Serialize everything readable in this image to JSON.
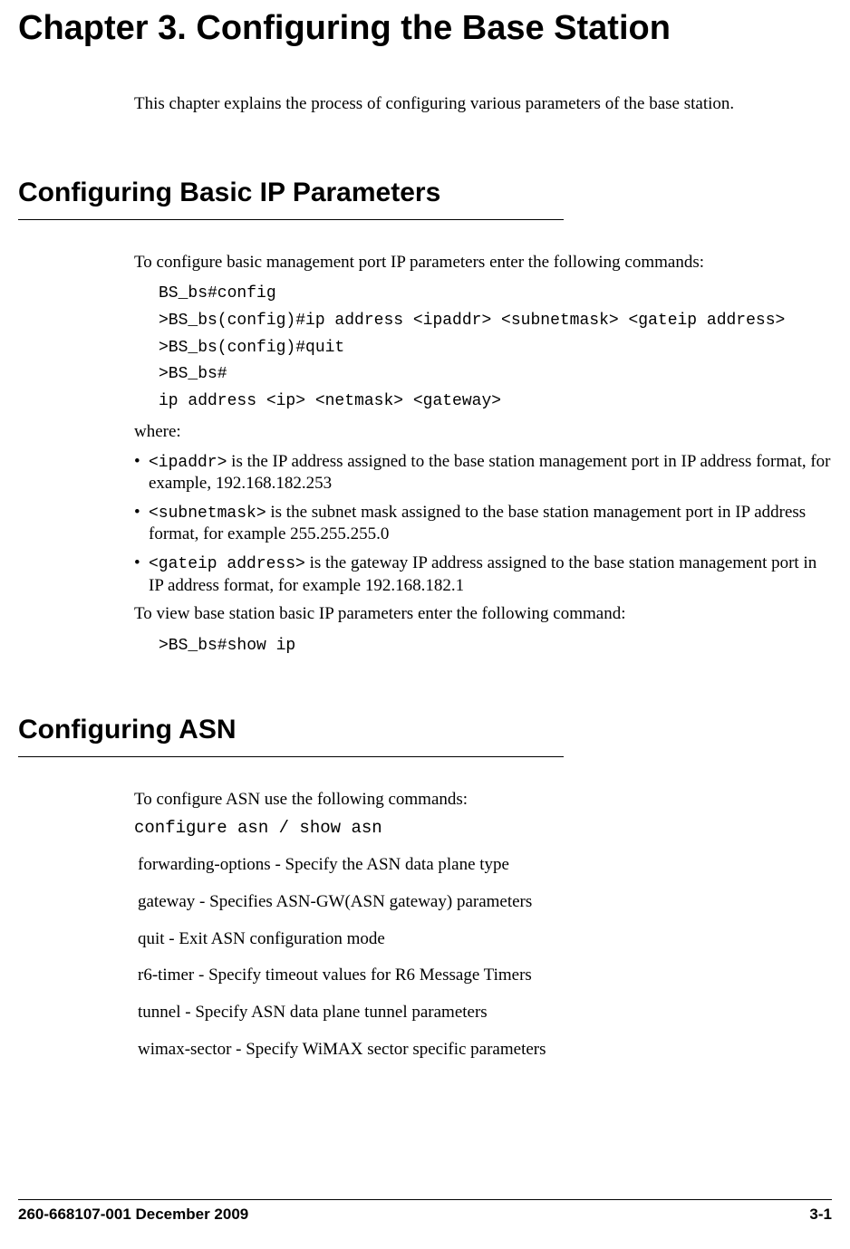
{
  "chapter": {
    "title": "Chapter 3. Configuring the Base Station",
    "intro": "This chapter explains the process of configuring various parameters of the base station."
  },
  "section1": {
    "heading": "Configuring Basic IP Parameters",
    "lead": "To configure basic management port IP parameters enter the following commands:",
    "code": "BS_bs#config\n>BS_bs(config)#ip address <ipaddr> <subnetmask> <gateip address>\n>BS_bs(config)#quit\n>BS_bs#\nip address <ip> <netmask> <gateway>",
    "where": "where:",
    "bullets": [
      {
        "term": "<ipaddr>",
        "desc": " is the IP address assigned to the base station management port in IP address format, for example, 192.168.182.253"
      },
      {
        "term": "<subnetmask>",
        "desc": " is the subnet mask assigned to the base station management port in IP address format, for example 255.255.255.0"
      },
      {
        "term": "<gateip address>",
        "desc": " is the gateway IP address assigned to the base station management port in IP address format, for example 192.168.182.1"
      }
    ],
    "view_text": "To view base station basic IP parameters enter the following command:",
    "view_cmd": ">BS_bs#show ip"
  },
  "section2": {
    "heading": "Configuring ASN",
    "lead": "To configure ASN use the following commands:",
    "cmd": "configure asn / show asn",
    "rows": [
      {
        "term": " forwarding-options   - ",
        "desc": "Specify the ASN data plane type"
      },
      {
        "term": " gateway             - ",
        "desc": "Specifies ASN-GW(ASN gateway) parameters"
      },
      {
        "term": " quit               - ",
        "desc": "Exit ASN configuration mode"
      },
      {
        "term": " r6-timer            - ",
        "desc": "Specify timeout values for R6 Message Timers"
      },
      {
        "term": " tunnel              - ",
        "desc": "Specify ASN data plane tunnel parameters"
      },
      {
        "term": " wimax-sector        - ",
        "desc": "Specify WiMAX sector specific parameters"
      }
    ]
  },
  "footer": {
    "left": "260-668107-001 December 2009",
    "right": "3-1"
  }
}
